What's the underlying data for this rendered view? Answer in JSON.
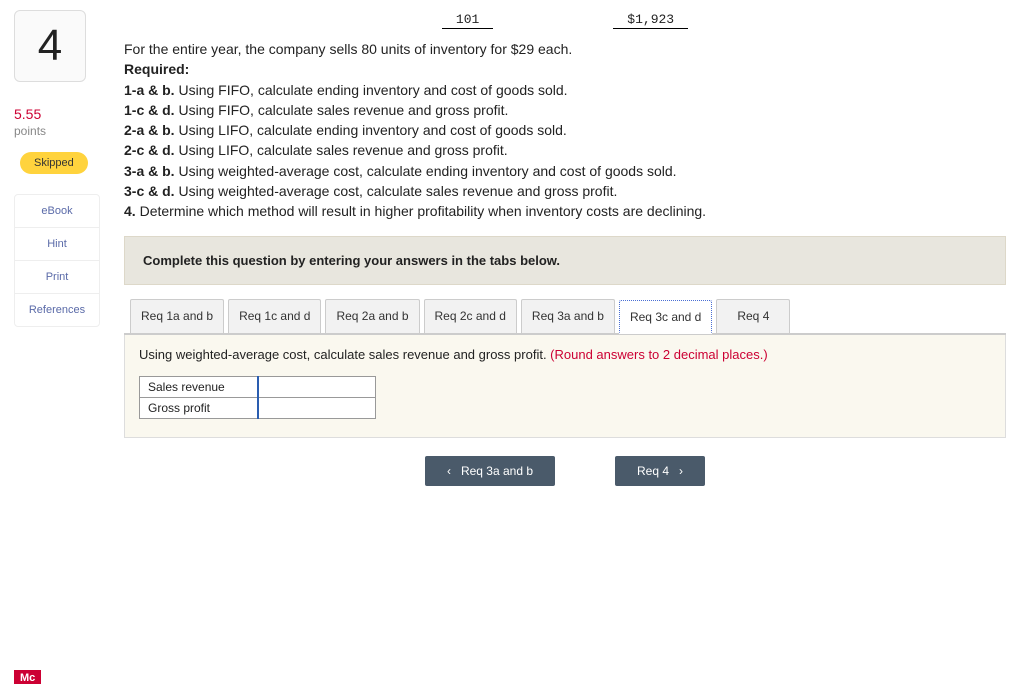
{
  "question_number": "4",
  "points": "5.55",
  "points_label": "points",
  "status_badge": "Skipped",
  "side_links": [
    "eBook",
    "Hint",
    "Print",
    "References"
  ],
  "top_values": {
    "left": "101",
    "right": "$1,923"
  },
  "intro": "For the entire year, the company sells 80 units of inventory for $29 each.",
  "required_title": "Required:",
  "requirements": [
    {
      "tag": "1-a & b.",
      "text": "Using FIFO, calculate ending inventory and cost of goods sold."
    },
    {
      "tag": "1-c & d.",
      "text": "Using FIFO, calculate sales revenue and gross profit."
    },
    {
      "tag": "2-a & b.",
      "text": "Using LIFO, calculate ending inventory and cost of goods sold."
    },
    {
      "tag": "2-c & d.",
      "text": "Using LIFO, calculate sales revenue and gross profit."
    },
    {
      "tag": "3-a & b.",
      "text": "Using weighted-average cost, calculate ending inventory and cost of goods sold."
    },
    {
      "tag": "3-c & d.",
      "text": "Using weighted-average cost, calculate sales revenue and gross profit."
    },
    {
      "tag": "4.",
      "text": "Determine which method will result in higher profitability when inventory costs are declining."
    }
  ],
  "instruction_bar": "Complete this question by entering your answers in the tabs below.",
  "tabs": [
    "Req 1a and b",
    "Req 1c and d",
    "Req 2a and b",
    "Req 2c and d",
    "Req 3a and b",
    "Req 3c and d",
    "Req 4"
  ],
  "active_tab_index": 5,
  "tab_prompt_main": "Using weighted-average cost, calculate sales revenue and gross profit. ",
  "tab_prompt_note": "(Round answers to 2 decimal places.)",
  "answer_rows": [
    "Sales revenue",
    "Gross profit"
  ],
  "nav_prev": "Req 3a and b",
  "nav_next": "Req 4",
  "brand": "Mc"
}
